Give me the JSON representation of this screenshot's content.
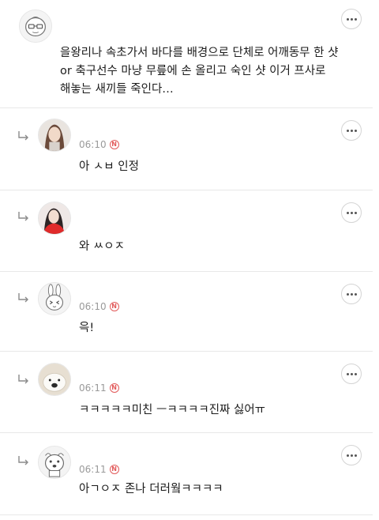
{
  "comments": [
    {
      "nickname": "",
      "time": "",
      "text": "을왕리나 속초가서 바다를 배경으로 단체로 어깨동무 한 샷\nor 축구선수 마냥 무릎에 손 올리고 숙인 샷 이거 프사로\n해놓는 새끼들 죽인다…",
      "avatar_icon": "doodle-face-icon"
    },
    {
      "nickname": "",
      "time": "06:10",
      "new_badge": "N",
      "text": "아 ㅅㅂ 인정",
      "avatar_icon": "woman-photo-icon"
    },
    {
      "nickname": "",
      "time": "",
      "new_badge": "",
      "text": "와 ㅆㅇㅈ",
      "avatar_icon": "red-shirt-photo-icon"
    },
    {
      "nickname": "",
      "time": "06:10",
      "new_badge": "N",
      "text": "윽!",
      "avatar_icon": "rabbit-doodle-icon"
    },
    {
      "nickname": "",
      "time": "06:11",
      "new_badge": "N",
      "text": "ㅋㅋㅋㅋㅋ미친 ㅡㅋㅋㅋㅋ진짜 싫어ㅠ",
      "avatar_icon": "dog-photo-icon"
    },
    {
      "nickname": "",
      "time": "06:11",
      "new_badge": "N",
      "text": "아ㄱㅇㅈ 존나 더러웤ㅋㅋㅋㅋ",
      "avatar_icon": "dog-doodle-icon"
    }
  ]
}
